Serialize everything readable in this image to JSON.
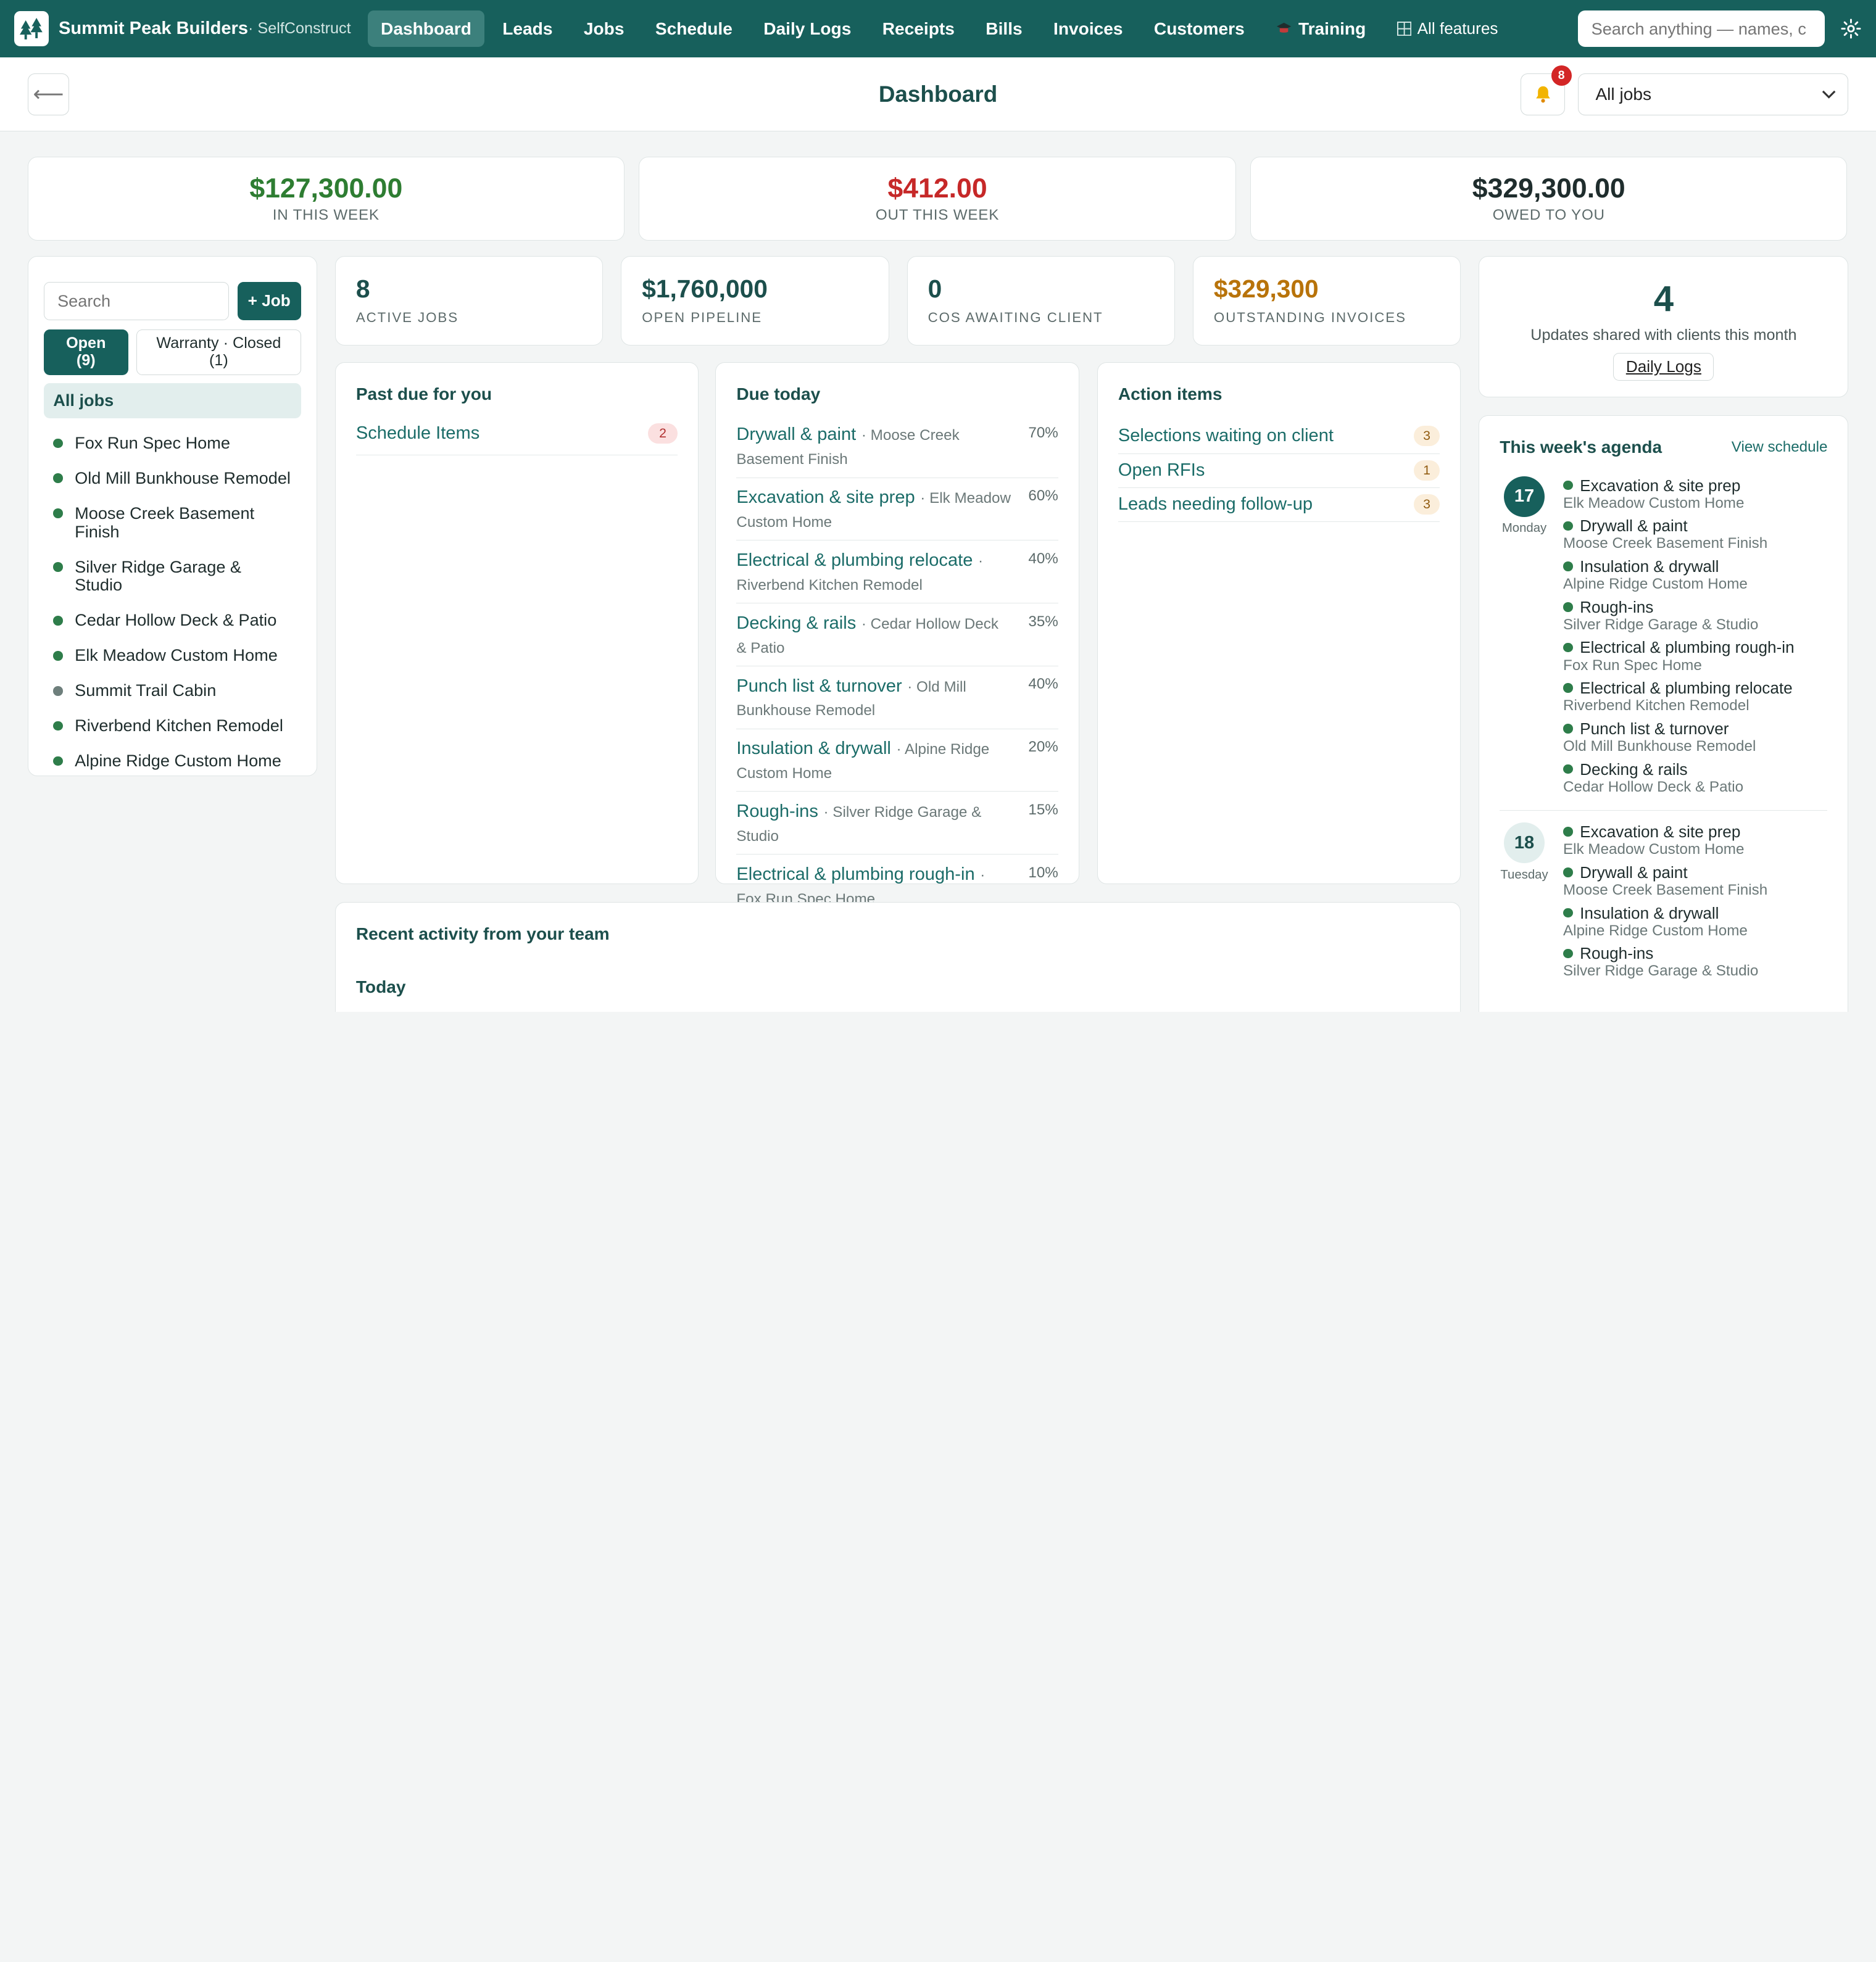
{
  "nav": {
    "brand": "Summit Peak Builders",
    "brand_sub": "· SelfConstruct",
    "items": [
      "Dashboard",
      "Leads",
      "Jobs",
      "Schedule",
      "Daily Logs",
      "Receipts",
      "Bills",
      "Invoices",
      "Customers"
    ],
    "training": "Training",
    "all_features": "All features",
    "search_placeholder": "Search anything — names, c"
  },
  "header": {
    "title": "Dashboard",
    "back_glyph": "⟵",
    "notif_count": "8",
    "job_filter": "All jobs"
  },
  "money": [
    {
      "amount": "$127,300.00",
      "label": "IN THIS WEEK",
      "color": "#2e7d32"
    },
    {
      "amount": "$412.00",
      "label": "OUT THIS WEEK",
      "color": "#c62828"
    },
    {
      "amount": "$329,300.00",
      "label": "OWED TO YOU",
      "color": "#1f2d2d"
    }
  ],
  "sidebar": {
    "search_placeholder": "Search",
    "add_job": "+ Job",
    "open_label": "Open",
    "open_count": "(9)",
    "closed_label": "Warranty · Closed",
    "closed_count": "(1)",
    "all_jobs": "All jobs",
    "jobs": [
      {
        "name": "Fox Run Spec Home",
        "status": "active"
      },
      {
        "name": "Old Mill Bunkhouse Remodel",
        "status": "active"
      },
      {
        "name": "Moose Creek Basement Finish",
        "status": "active"
      },
      {
        "name": "Silver Ridge Garage & Studio",
        "status": "active"
      },
      {
        "name": "Cedar Hollow Deck & Patio",
        "status": "active"
      },
      {
        "name": "Elk Meadow Custom Home",
        "status": "active"
      },
      {
        "name": "Summit Trail Cabin",
        "status": "inactive"
      },
      {
        "name": "Riverbend Kitchen Remodel",
        "status": "active"
      },
      {
        "name": "Alpine Ridge Custom Home",
        "status": "active"
      }
    ]
  },
  "stats": [
    {
      "value": "8",
      "label": "ACTIVE JOBS",
      "color": "#1c4f4c"
    },
    {
      "value": "$1,760,000",
      "label": "OPEN PIPELINE",
      "color": "#1c4f4c"
    },
    {
      "value": "0",
      "label": "COS AWAITING CLIENT",
      "color": "#1c4f4c"
    },
    {
      "value": "$329,300",
      "label": "OUTSTANDING INVOICES",
      "color": "#b8730a"
    }
  ],
  "updates": {
    "value": "4",
    "label": "Updates shared with clients this month",
    "button": "Daily Logs"
  },
  "past_due": {
    "title": "Past due for you",
    "items": [
      {
        "label": "Schedule Items",
        "count": "2"
      }
    ]
  },
  "due_today": {
    "title": "Due today",
    "items": [
      {
        "task": "Drywall & paint",
        "job": "· Moose Creek Basement Finish",
        "pct": "70%"
      },
      {
        "task": "Excavation & site prep",
        "job": "· Elk Meadow Custom Home",
        "pct": "60%"
      },
      {
        "task": "Electrical & plumbing relocate",
        "job": "· Riverbend Kitchen Remodel",
        "pct": "40%"
      },
      {
        "task": "Decking & rails",
        "job": "· Cedar Hollow Deck & Patio",
        "pct": "35%"
      },
      {
        "task": "Punch list & turnover",
        "job": "· Old Mill Bunkhouse Remodel",
        "pct": "40%"
      },
      {
        "task": "Insulation & drywall",
        "job": "· Alpine Ridge Custom Home",
        "pct": "20%"
      },
      {
        "task": "Rough-ins",
        "job": "· Silver Ridge Garage & Studio",
        "pct": "15%"
      },
      {
        "task": "Electrical & plumbing rough-in",
        "job": "· Fox Run Spec Home",
        "pct": "10%"
      }
    ]
  },
  "action_items": {
    "title": "Action items",
    "items": [
      {
        "label": "Selections waiting on client",
        "count": "3"
      },
      {
        "label": "Open RFIs",
        "count": "1"
      },
      {
        "label": "Leads needing follow-up",
        "count": "3"
      }
    ]
  },
  "agenda": {
    "title": "This week's agenda",
    "link": "View schedule",
    "days": [
      {
        "date": "17",
        "weekday": "Monday",
        "events": [
          {
            "task": "Excavation & site prep",
            "job": "Elk Meadow Custom Home"
          },
          {
            "task": "Drywall & paint",
            "job": "Moose Creek Basement Finish"
          },
          {
            "task": "Insulation & drywall",
            "job": "Alpine Ridge Custom Home"
          },
          {
            "task": "Rough-ins",
            "job": "Silver Ridge Garage & Studio"
          },
          {
            "task": "Electrical & plumbing rough-in",
            "job": "Fox Run Spec Home"
          },
          {
            "task": "Electrical & plumbing relocate",
            "job": "Riverbend Kitchen Remodel"
          },
          {
            "task": "Punch list & turnover",
            "job": "Old Mill Bunkhouse Remodel"
          },
          {
            "task": "Decking & rails",
            "job": "Cedar Hollow Deck & Patio"
          }
        ]
      },
      {
        "date": "18",
        "weekday": "Tuesday",
        "events": [
          {
            "task": "Excavation & site prep",
            "job": "Elk Meadow Custom Home"
          },
          {
            "task": "Drywall & paint",
            "job": "Moose Creek Basement Finish"
          },
          {
            "task": "Insulation & drywall",
            "job": "Alpine Ridge Custom Home"
          },
          {
            "task": "Rough-ins",
            "job": "Silver Ridge Garage & Studio"
          }
        ]
      }
    ]
  },
  "activity": {
    "title": "Recent activity from your team",
    "today": "Today"
  }
}
